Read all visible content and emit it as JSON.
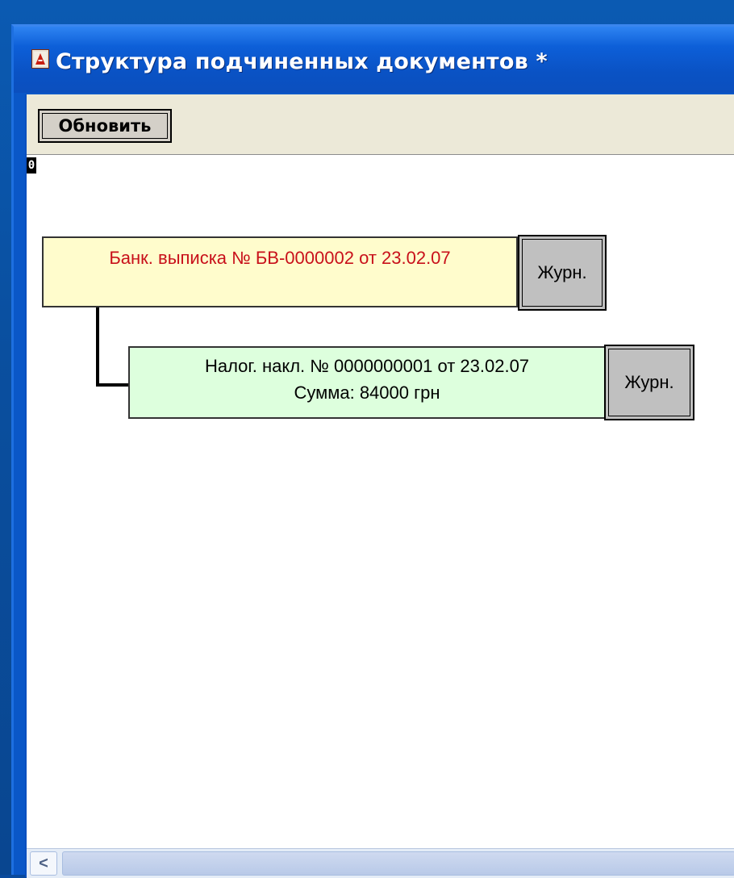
{
  "window": {
    "title": "Структура подчиненных документов  *"
  },
  "toolbar": {
    "refresh_label": "Обновить"
  },
  "canvas": {
    "origin_marker": "0"
  },
  "documents": [
    {
      "line1": "Банк. выписка № БВ-0000002 от 23.02.07",
      "line2": "",
      "journal_label": "Журн."
    },
    {
      "line1": "Налог. накл. № 0000000001 от 23.02.07",
      "line2": "Сумма: 84000 грн",
      "journal_label": "Журн."
    }
  ],
  "scrollbar": {
    "left_arrow": "<"
  },
  "colors": {
    "parent_doc_bg": "#fffccc",
    "parent_doc_text": "#c8101a",
    "child_doc_bg": "#ddffdd",
    "titlebar": "#0a52c4"
  },
  "icons": {
    "app": "document-app-icon"
  }
}
